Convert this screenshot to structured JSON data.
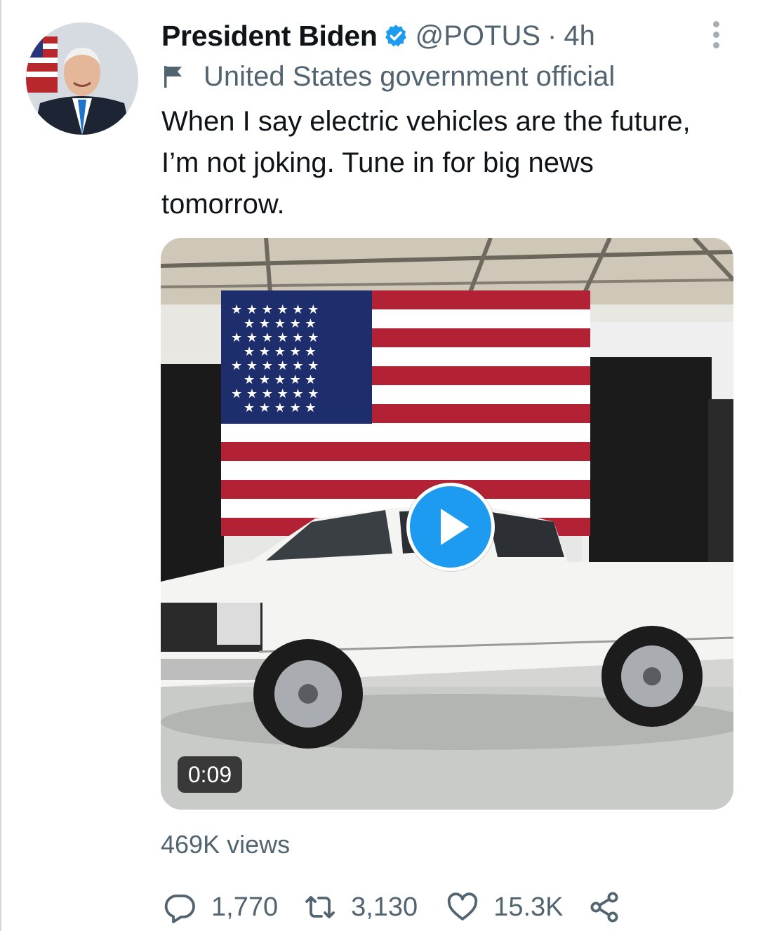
{
  "author": {
    "name": "President Biden",
    "handle": "@POTUS",
    "separator": "·",
    "time": "4h",
    "verified": true,
    "label": "United States government official"
  },
  "tweet": {
    "text": "When I say electric vehicles are the future, I’m not joking. Tune in for big news tomorrow."
  },
  "media": {
    "type": "video",
    "duration": "0:09"
  },
  "views": "469K views",
  "actions": {
    "reply_count": "1,770",
    "retweet_count": "3,130",
    "like_count": "15.3K"
  },
  "colors": {
    "accent": "#1d9bf0",
    "text": "#0f1419",
    "secondary": "#536471"
  },
  "icons": [
    "verified-badge-icon",
    "flag-icon",
    "more-icon",
    "play-icon",
    "reply-icon",
    "retweet-icon",
    "like-icon",
    "share-icon"
  ]
}
